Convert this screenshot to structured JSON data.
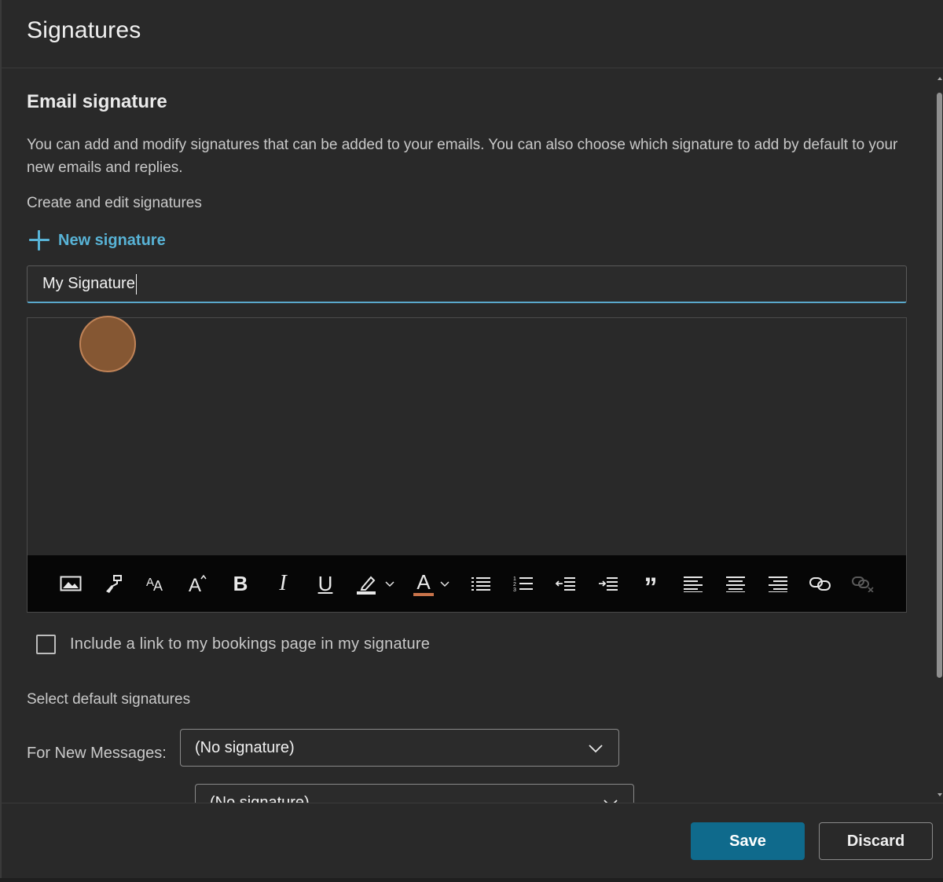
{
  "dialog": {
    "title": "Signatures"
  },
  "email_signature": {
    "title": "Email signature",
    "description": "You can add and modify signatures that can be added to your emails. You can also choose which signature to add by default to your new emails and replies.",
    "create_label": "Create and edit signatures",
    "new_signature_label": "New signature",
    "signature_name_value": "My Signature",
    "editor_value": ""
  },
  "toolbar": {
    "buttons": [
      {
        "name": "insert-picture-icon"
      },
      {
        "name": "format-painter-icon"
      },
      {
        "name": "font-size-icon"
      },
      {
        "name": "increase-font-size-icon"
      },
      {
        "name": "bold-icon",
        "glyph": "B"
      },
      {
        "name": "italic-icon",
        "glyph": "I"
      },
      {
        "name": "underline-icon",
        "glyph": "U"
      },
      {
        "name": "highlight-icon"
      },
      {
        "name": "font-color-icon",
        "glyph": "A"
      },
      {
        "name": "bullets-icon"
      },
      {
        "name": "numbering-icon"
      },
      {
        "name": "decrease-indent-icon"
      },
      {
        "name": "increase-indent-icon"
      },
      {
        "name": "quote-icon",
        "glyph": "”"
      },
      {
        "name": "align-left-icon"
      },
      {
        "name": "align-center-icon"
      },
      {
        "name": "align-right-icon"
      },
      {
        "name": "insert-link-icon"
      },
      {
        "name": "remove-link-icon"
      }
    ],
    "colors": {
      "highlight": "#e8e8e8",
      "font_color": "#c8734a"
    }
  },
  "bookings": {
    "label": "Include a link to my bookings page in my signature",
    "checked": false
  },
  "defaults": {
    "title": "Select default signatures",
    "new_messages_label": "For New Messages:",
    "new_messages_value": "(No signature)",
    "replies_value": "(No signature)"
  },
  "footer": {
    "save_label": "Save",
    "discard_label": "Discard"
  },
  "colors": {
    "accent": "#58b3d6",
    "primary_button": "#0f6a8c",
    "background": "#292929"
  }
}
